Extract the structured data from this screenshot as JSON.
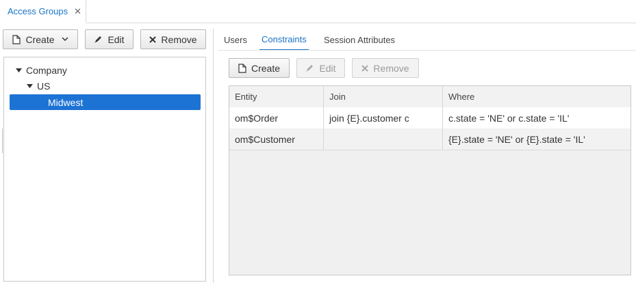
{
  "app_tabs": [
    {
      "label": "Access Groups"
    }
  ],
  "left_toolbar": {
    "create_label": "Create",
    "edit_label": "Edit",
    "remove_label": "Remove"
  },
  "tree": {
    "nodes": [
      {
        "label": "Company",
        "expanded": true
      },
      {
        "label": "US",
        "expanded": true
      },
      {
        "label": "Midwest",
        "selected": true
      }
    ]
  },
  "subtabs": [
    {
      "label": "Users"
    },
    {
      "label": "Constraints",
      "active": true
    },
    {
      "label": "Session Attributes"
    }
  ],
  "constraints_toolbar": {
    "create_label": "Create",
    "edit_label": "Edit",
    "remove_label": "Remove"
  },
  "table": {
    "columns": [
      "Entity",
      "Join",
      "Where"
    ],
    "rows": [
      {
        "entity": "om$Order",
        "join": "join {E}.customer c",
        "where": "c.state = 'NE' or c.state = 'IL'"
      },
      {
        "entity": "om$Customer",
        "join": "",
        "where": "{E}.state = 'NE' or {E}.state = 'IL'"
      }
    ]
  },
  "colors": {
    "accent": "#1a73c5",
    "selection": "#1d73d4"
  }
}
